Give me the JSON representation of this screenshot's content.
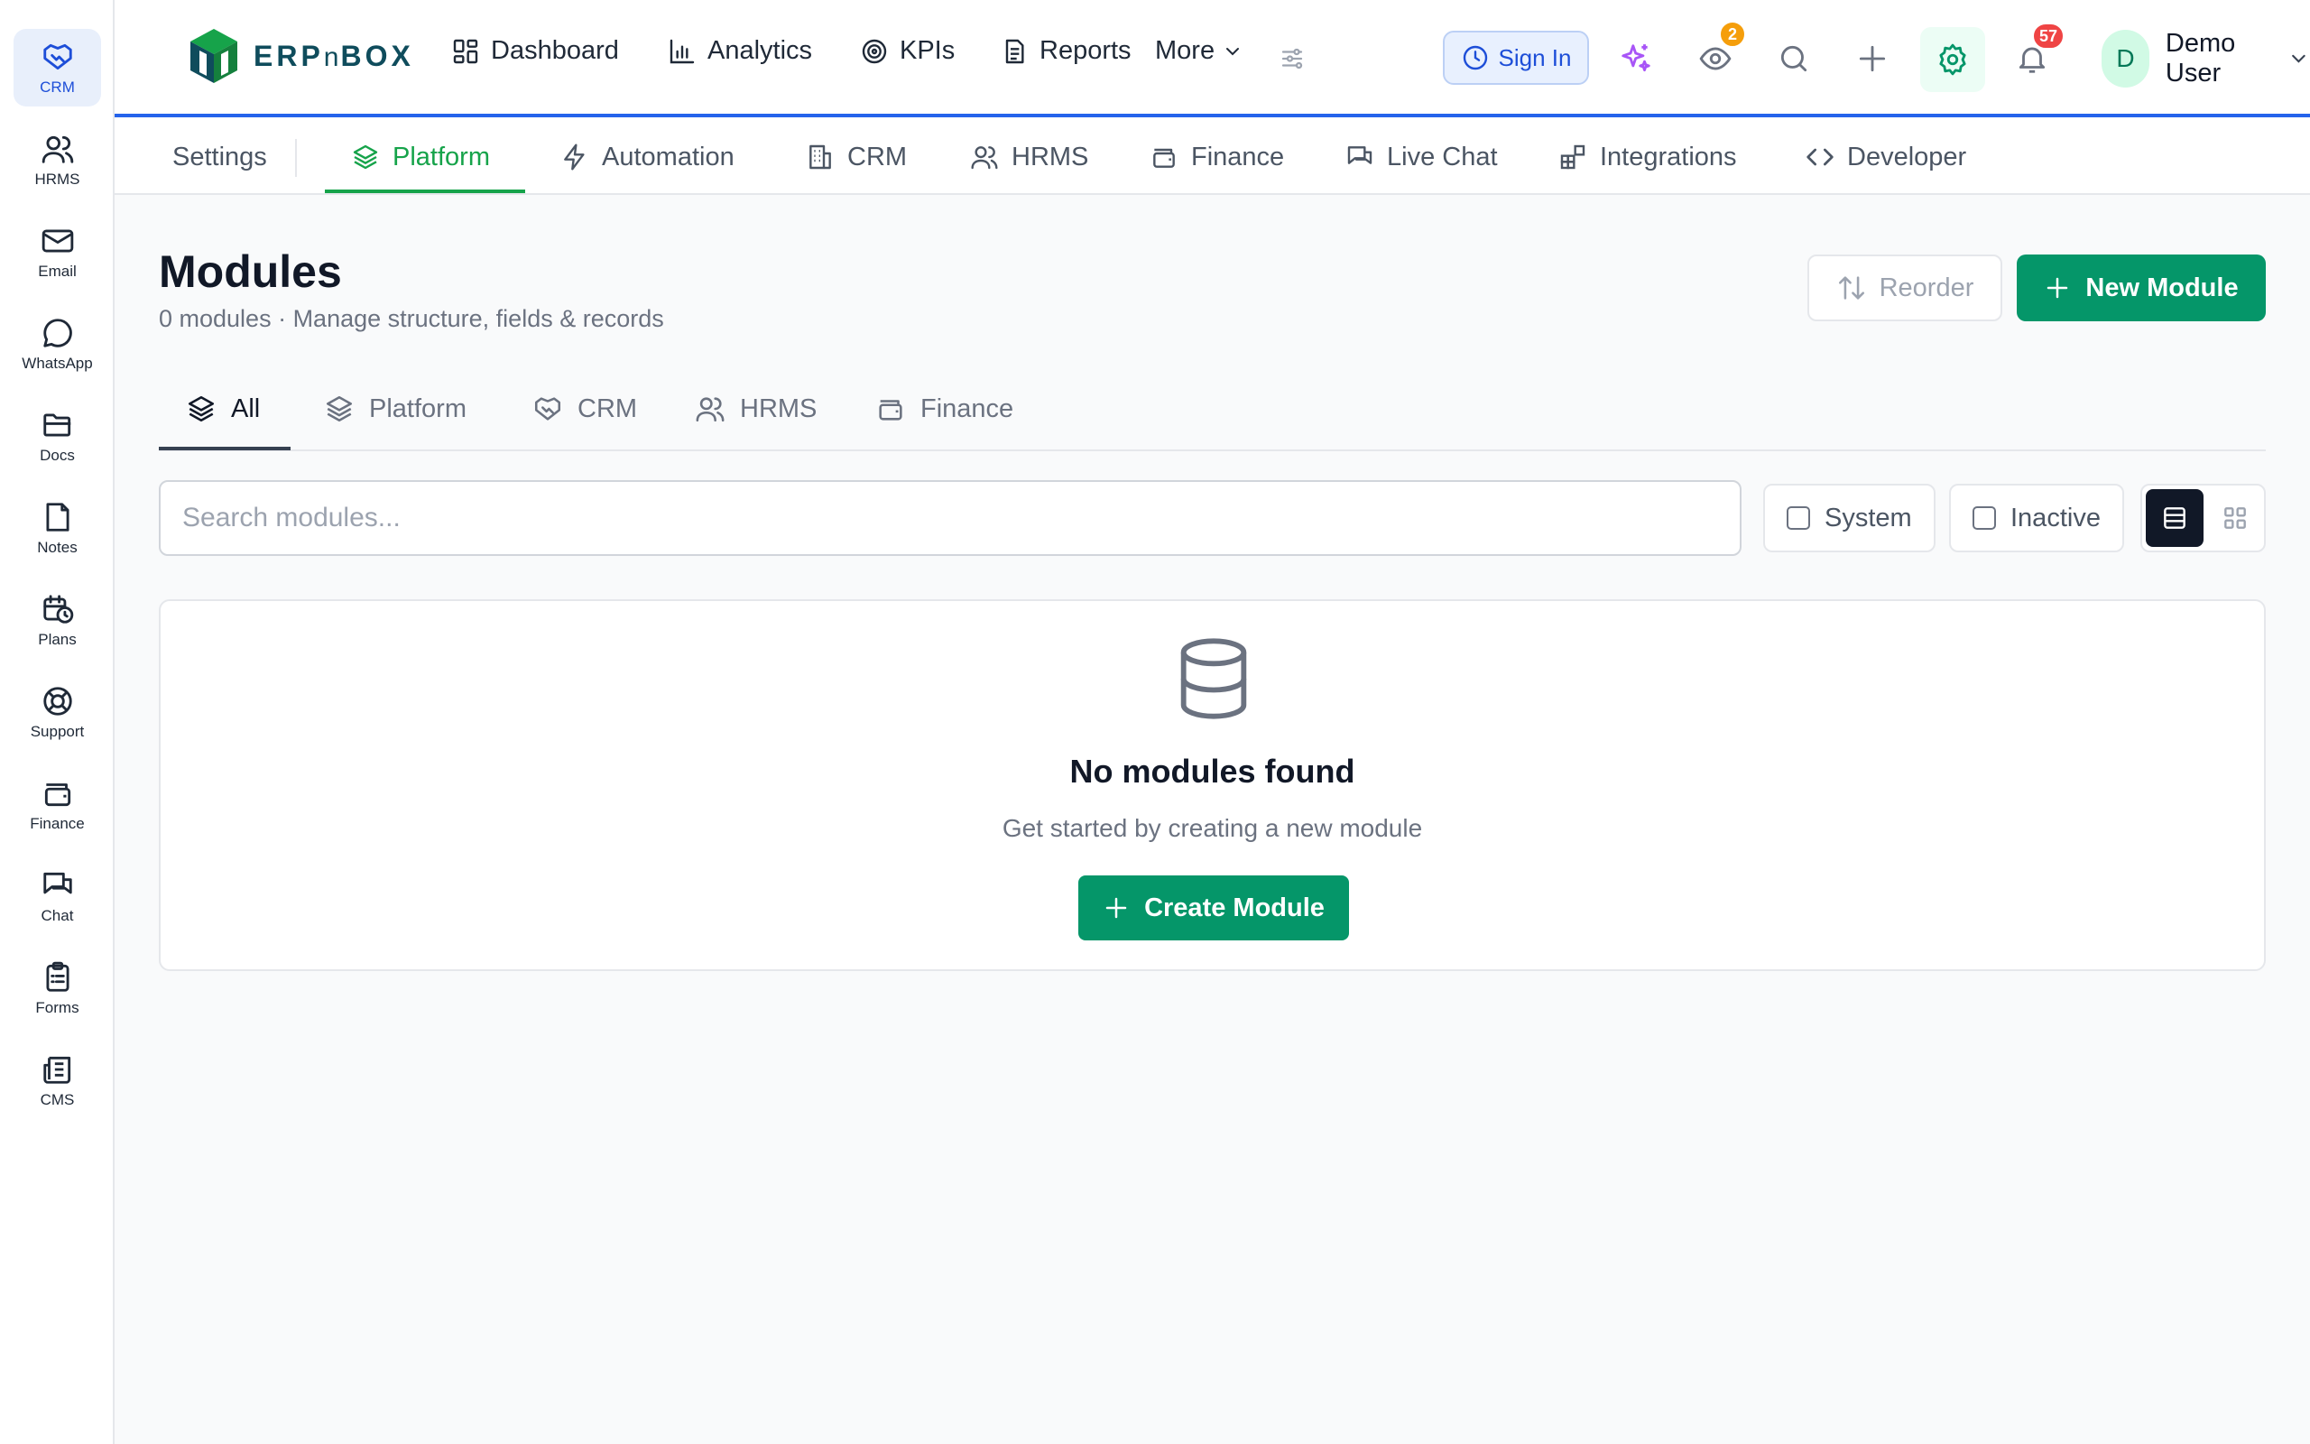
{
  "rail": {
    "items": [
      {
        "label": "CRM",
        "icon": "handshake-icon",
        "active": true
      },
      {
        "label": "HRMS",
        "icon": "users-icon"
      },
      {
        "label": "Email",
        "icon": "mail-icon"
      },
      {
        "label": "WhatsApp",
        "icon": "chat-bubble-icon"
      },
      {
        "label": "Docs",
        "icon": "folder-icon"
      },
      {
        "label": "Notes",
        "icon": "note-icon"
      },
      {
        "label": "Plans",
        "icon": "calendar-clock-icon"
      },
      {
        "label": "Support",
        "icon": "lifebuoy-icon"
      },
      {
        "label": "Finance",
        "icon": "wallet-icon"
      },
      {
        "label": "Chat",
        "icon": "messages-icon"
      },
      {
        "label": "Forms",
        "icon": "clipboard-icon"
      },
      {
        "label": "CMS",
        "icon": "newspaper-icon"
      }
    ]
  },
  "header": {
    "logo_text_a": "ERP",
    "logo_text_b": "n",
    "logo_text_c": "BOX",
    "nav": {
      "dashboard": "Dashboard",
      "analytics": "Analytics",
      "kpis": "KPIs",
      "reports": "Reports",
      "more": "More"
    },
    "sign_in": "Sign In",
    "watch_count": "2",
    "notification_count": "57",
    "user_initial": "D",
    "user_name": "Demo User",
    "colors": {
      "accent_blue": "#2563eb",
      "ai_purple": "#a855f7",
      "badge_orange": "#f59e0b",
      "badge_red": "#ef4444"
    }
  },
  "settings_tabs": {
    "settings": "Settings",
    "platform": "Platform",
    "automation": "Automation",
    "crm": "CRM",
    "hrms": "HRMS",
    "finance": "Finance",
    "live_chat": "Live Chat",
    "integrations": "Integrations",
    "developer": "Developer",
    "active": "Platform"
  },
  "main": {
    "title": "Modules",
    "subtitle": "0 modules · Manage structure, fields & records",
    "reorder": "Reorder",
    "new_module": "New Module",
    "category_tabs": {
      "all": "All",
      "platform": "Platform",
      "crm": "CRM",
      "hrms": "HRMS",
      "finance": "Finance",
      "active": "All"
    },
    "search": {
      "placeholder": "Search modules...",
      "value": ""
    },
    "filters": {
      "system": "System",
      "inactive": "Inactive"
    },
    "view_mode": "list",
    "empty": {
      "title": "No modules found",
      "subtitle": "Get started by creating a new module",
      "button": "Create Module"
    },
    "colors": {
      "primary_green": "#059669",
      "tab_green": "#16a34a"
    }
  }
}
